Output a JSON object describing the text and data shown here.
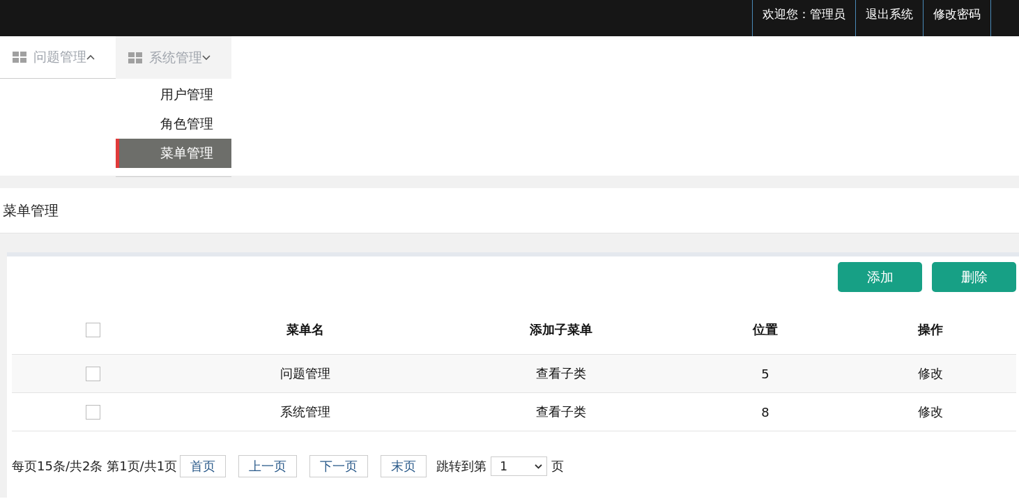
{
  "topbar": {
    "items": [
      {
        "label": "欢迎您：管理员"
      },
      {
        "label": "退出系统"
      },
      {
        "label": "修改密码"
      }
    ]
  },
  "nav": [
    {
      "label": "问题管理",
      "expanded": false
    },
    {
      "label": "系统管理",
      "expanded": true,
      "children": [
        {
          "label": "用户管理",
          "selected": false
        },
        {
          "label": "角色管理",
          "selected": false
        },
        {
          "label": "菜单管理",
          "selected": true
        }
      ]
    }
  ],
  "page_title": "菜单管理",
  "actions": [
    "添加",
    "删除"
  ],
  "table": {
    "header_checked": false,
    "columns": [
      "菜单名",
      "添加子菜单",
      "位置",
      "操作"
    ],
    "rows": [
      {
        "checked": false,
        "cells": [
          "问题管理",
          "查看子类",
          "5",
          "修改"
        ]
      },
      {
        "checked": false,
        "cells": [
          "系统管理",
          "查看子类",
          "8",
          "修改"
        ]
      }
    ]
  },
  "pagination": {
    "summary": "每页15条/共2条 第1页/共1页",
    "buttons": [
      "首页",
      "上一页",
      "下一页",
      "末页"
    ],
    "jump_label": "跳转到第",
    "page_value": "1",
    "page_suffix": "页"
  }
}
